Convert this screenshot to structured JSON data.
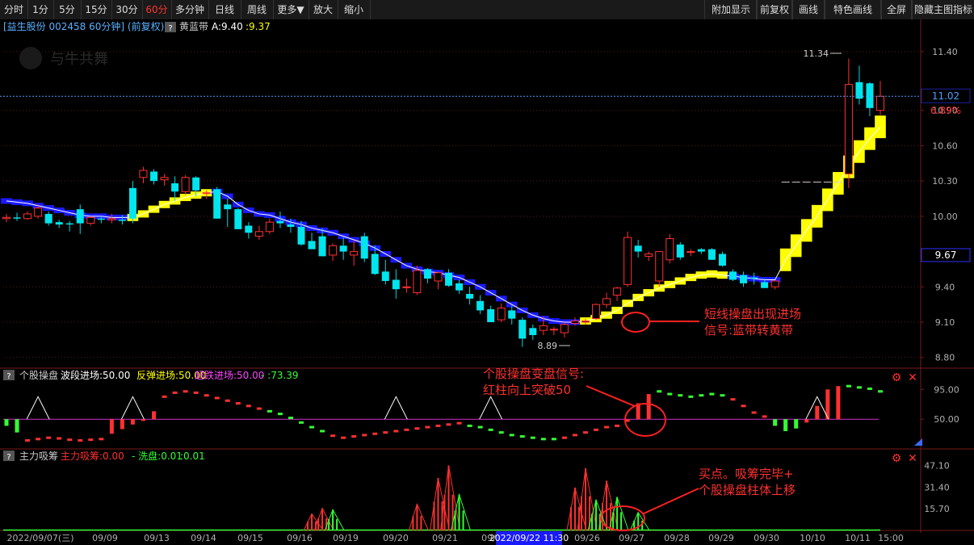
{
  "toolbar": {
    "left": [
      "分时",
      "1分",
      "5分",
      "15分",
      "30分",
      "60分",
      "多分钟",
      "日线",
      "周线",
      "更多▼",
      "放大",
      "缩小"
    ],
    "active": "60分",
    "right": [
      "附加显示",
      "前复权",
      "画线",
      "特色画线",
      "全屏",
      "隐藏主图指标"
    ]
  },
  "info_bar": {
    "stock": "[益生股份 002458 60分钟] (前复权)",
    "indicator_name": "黄蓝带",
    "a_text": "A:9.40",
    "b_text": ":9.37"
  },
  "colors": {
    "up": "#ff3030",
    "down": "#00e5ee",
    "band_yellow": "#ffff00",
    "band_blue": "#1a1aff",
    "bg": "#000000",
    "grid": "#5a1a1a",
    "axis_text": "#b0b0b0"
  },
  "annotations": {
    "main": "短线操盘出现进场\n信号:蓝带转黄带",
    "sub1": "个股操盘变盘信号:\n红柱向上突破50",
    "sub2": "买点。吸筹完毕+\n个股操盘柱体上移"
  },
  "panel1": {
    "title": "个股操盘",
    "legend": [
      {
        "text": "波段进场:50.00",
        "color": "#ffffff"
      },
      {
        "text": "反弹进场:50.00",
        "color": "#ffff00"
      },
      {
        "text": "超跌进场:50.00",
        "color": "#ff44ff"
      },
      {
        "text": "- :73.39",
        "color": "#33ff33"
      }
    ]
  },
  "panel2": {
    "title": "主力吸筹",
    "legend": [
      {
        "text": "主力吸筹:0.00",
        "color": "#ff3030"
      },
      {
        "text": "- 洗盘:0.01",
        "color": "#33ff33"
      },
      {
        "text": ":0.01",
        "color": "#33ff33"
      }
    ]
  },
  "x_labels": [
    "2022/09/07(三)",
    "09/09",
    "09/13",
    "09/14",
    "09/15",
    "09/16",
    "09/19",
    "09/20",
    "09/21",
    "09/22",
    "09/26",
    "09/27",
    "09/28",
    "09/29",
    "09/30",
    "10/10",
    "10/11",
    "15:00"
  ],
  "cursor_label": "2022/09/22 11:30",
  "chart_data": [
    {
      "type": "candlestick",
      "title": "益生股份 002458 60分钟",
      "y_ticks": [
        8.8,
        9.1,
        9.4,
        10.0,
        10.3,
        10.6,
        10.9,
        11.4
      ],
      "ylim": [
        8.75,
        11.55
      ],
      "price_tags": {
        "last": "11.02",
        "pct": "6.89%",
        "band": "9.67"
      },
      "annotations_price": {
        "high": "11.34",
        "low": "8.89"
      },
      "ohlc": [
        [
          9.98,
          10.02,
          9.95,
          9.99
        ],
        [
          9.99,
          10.03,
          9.96,
          9.98
        ],
        [
          9.98,
          10.04,
          9.97,
          10.02
        ],
        [
          10.0,
          10.1,
          9.98,
          10.07
        ],
        [
          10.02,
          10.04,
          9.92,
          9.94
        ],
        [
          9.95,
          9.97,
          9.9,
          9.93
        ],
        [
          9.94,
          9.96,
          9.87,
          9.93
        ],
        [
          10.06,
          10.1,
          9.85,
          9.94
        ],
        [
          9.94,
          10.0,
          9.92,
          9.99
        ],
        [
          9.98,
          10.0,
          9.94,
          9.97
        ],
        [
          9.97,
          10.02,
          9.94,
          9.98
        ],
        [
          9.97,
          10.01,
          9.93,
          9.96
        ],
        [
          10.24,
          10.3,
          9.94,
          9.98
        ],
        [
          10.33,
          10.42,
          10.28,
          10.39
        ],
        [
          10.38,
          10.4,
          10.27,
          10.3
        ],
        [
          10.31,
          10.36,
          10.26,
          10.33
        ],
        [
          10.28,
          10.34,
          10.13,
          10.21
        ],
        [
          10.21,
          10.35,
          10.18,
          10.33
        ],
        [
          10.33,
          10.34,
          10.17,
          10.22
        ],
        [
          10.2,
          10.22,
          10.15,
          10.2
        ],
        [
          10.23,
          10.25,
          9.98,
          9.98
        ],
        [
          10.1,
          10.15,
          9.91,
          10.06
        ],
        [
          10.06,
          10.07,
          9.89,
          9.89
        ],
        [
          9.92,
          9.95,
          9.81,
          9.86
        ],
        [
          9.83,
          9.92,
          9.8,
          9.87
        ],
        [
          9.87,
          9.98,
          9.85,
          9.95
        ],
        [
          9.96,
          10.04,
          9.9,
          9.94
        ],
        [
          9.93,
          9.98,
          9.86,
          9.91
        ],
        [
          9.91,
          9.96,
          9.75,
          9.76
        ],
        [
          9.79,
          9.86,
          9.72,
          9.72
        ],
        [
          9.83,
          9.9,
          9.66,
          9.66
        ],
        [
          9.67,
          9.77,
          9.62,
          9.75
        ],
        [
          9.75,
          9.82,
          9.63,
          9.7
        ],
        [
          9.67,
          9.8,
          9.58,
          9.7
        ],
        [
          9.83,
          9.86,
          9.61,
          9.64
        ],
        [
          9.68,
          9.75,
          9.5,
          9.51
        ],
        [
          9.53,
          9.63,
          9.42,
          9.45
        ],
        [
          9.46,
          9.55,
          9.3,
          9.38
        ],
        [
          9.4,
          9.47,
          9.35,
          9.4
        ],
        [
          9.35,
          9.58,
          9.33,
          9.54
        ],
        [
          9.55,
          9.56,
          9.43,
          9.47
        ],
        [
          9.45,
          9.53,
          9.38,
          9.52
        ],
        [
          9.52,
          9.55,
          9.4,
          9.41
        ],
        [
          9.43,
          9.46,
          9.34,
          9.37
        ],
        [
          9.34,
          9.4,
          9.25,
          9.3
        ],
        [
          9.28,
          9.33,
          9.17,
          9.2
        ],
        [
          9.21,
          9.24,
          9.1,
          9.1
        ],
        [
          9.12,
          9.26,
          9.1,
          9.22
        ],
        [
          9.2,
          9.24,
          9.08,
          9.13
        ],
        [
          9.12,
          9.14,
          8.89,
          8.96
        ],
        [
          9.05,
          9.08,
          8.95,
          8.99
        ],
        [
          9.03,
          9.15,
          8.99,
          9.07
        ],
        [
          9.04,
          9.06,
          8.99,
          9.04
        ],
        [
          9.01,
          9.1,
          8.97,
          9.08
        ],
        [
          9.09,
          9.14,
          9.07,
          9.11
        ],
        [
          9.1,
          9.13,
          9.08,
          9.11
        ],
        [
          9.13,
          9.26,
          9.12,
          9.25
        ],
        [
          9.25,
          9.35,
          9.22,
          9.3
        ],
        [
          9.33,
          9.4,
          9.28,
          9.39
        ],
        [
          9.42,
          9.87,
          9.4,
          9.82
        ],
        [
          9.75,
          9.8,
          9.65,
          9.7
        ],
        [
          9.66,
          9.7,
          9.62,
          9.68
        ],
        [
          9.45,
          9.7,
          9.4,
          9.7
        ],
        [
          9.63,
          9.85,
          9.6,
          9.81
        ],
        [
          9.76,
          9.78,
          9.63,
          9.65
        ],
        [
          9.7,
          9.72,
          9.66,
          9.7
        ],
        [
          9.72,
          9.73,
          9.68,
          9.7
        ],
        [
          9.72,
          9.73,
          9.63,
          9.63
        ],
        [
          9.68,
          9.7,
          9.57,
          9.58
        ],
        [
          9.53,
          9.55,
          9.45,
          9.46
        ],
        [
          9.5,
          9.53,
          9.4,
          9.43
        ],
        [
          9.48,
          9.52,
          9.42,
          9.47
        ],
        [
          9.44,
          9.47,
          9.39,
          9.39
        ],
        [
          9.4,
          9.45,
          9.38,
          9.45
        ],
        [
          10.29,
          10.29,
          10.29,
          10.29
        ],
        [
          10.29,
          10.29,
          10.29,
          10.29
        ],
        [
          10.29,
          10.29,
          10.29,
          10.29
        ],
        [
          10.29,
          10.29,
          10.29,
          10.29
        ],
        [
          10.29,
          10.29,
          10.29,
          10.29
        ],
        [
          10.29,
          10.29,
          10.29,
          10.29
        ],
        [
          10.36,
          11.34,
          10.24,
          11.12
        ],
        [
          11.14,
          11.28,
          10.95,
          11.0
        ],
        [
          11.13,
          11.14,
          10.85,
          10.92
        ],
        [
          10.9,
          11.15,
          10.86,
          11.02
        ]
      ],
      "band": [
        [
          10.13,
          "b"
        ],
        [
          10.12,
          "b"
        ],
        [
          10.11,
          "b"
        ],
        [
          10.09,
          "b"
        ],
        [
          10.07,
          "b"
        ],
        [
          10.05,
          "b"
        ],
        [
          10.03,
          "b"
        ],
        [
          10.01,
          "b"
        ],
        [
          10.0,
          "b"
        ],
        [
          10.0,
          "b"
        ],
        [
          9.99,
          "b"
        ],
        [
          9.99,
          "b"
        ],
        [
          9.99,
          "y"
        ],
        [
          10.02,
          "y"
        ],
        [
          10.06,
          "y"
        ],
        [
          10.1,
          "y"
        ],
        [
          10.13,
          "y"
        ],
        [
          10.16,
          "y"
        ],
        [
          10.18,
          "y"
        ],
        [
          10.2,
          "y"
        ],
        [
          10.21,
          "b"
        ],
        [
          10.17,
          "b"
        ],
        [
          10.1,
          "b"
        ],
        [
          10.05,
          "b"
        ],
        [
          10.02,
          "b"
        ],
        [
          10.01,
          "b"
        ],
        [
          9.98,
          "b"
        ],
        [
          9.95,
          "b"
        ],
        [
          9.93,
          "b"
        ],
        [
          9.9,
          "b"
        ],
        [
          9.88,
          "b"
        ],
        [
          9.86,
          "b"
        ],
        [
          9.83,
          "b"
        ],
        [
          9.8,
          "b"
        ],
        [
          9.77,
          "b"
        ],
        [
          9.73,
          "b"
        ],
        [
          9.68,
          "b"
        ],
        [
          9.63,
          "b"
        ],
        [
          9.58,
          "b"
        ],
        [
          9.55,
          "b"
        ],
        [
          9.53,
          "b"
        ],
        [
          9.52,
          "b"
        ],
        [
          9.5,
          "b"
        ],
        [
          9.48,
          "b"
        ],
        [
          9.44,
          "b"
        ],
        [
          9.4,
          "b"
        ],
        [
          9.35,
          "b"
        ],
        [
          9.3,
          "b"
        ],
        [
          9.25,
          "b"
        ],
        [
          9.2,
          "b"
        ],
        [
          9.16,
          "b"
        ],
        [
          9.13,
          "b"
        ],
        [
          9.11,
          "b"
        ],
        [
          9.1,
          "b"
        ],
        [
          9.1,
          "b"
        ],
        [
          9.11,
          "y"
        ],
        [
          9.13,
          "y"
        ],
        [
          9.16,
          "y"
        ],
        [
          9.2,
          "y"
        ],
        [
          9.26,
          "y"
        ],
        [
          9.31,
          "y"
        ],
        [
          9.35,
          "y"
        ],
        [
          9.39,
          "y"
        ],
        [
          9.42,
          "y"
        ],
        [
          9.45,
          "y"
        ],
        [
          9.48,
          "y"
        ],
        [
          9.5,
          "y"
        ],
        [
          9.51,
          "y"
        ],
        [
          9.5,
          "y"
        ],
        [
          9.49,
          "b"
        ],
        [
          9.48,
          "b"
        ],
        [
          9.47,
          "b"
        ],
        [
          9.46,
          "b"
        ],
        [
          9.46,
          "b"
        ],
        [
          9.63,
          "y"
        ],
        [
          9.75,
          "y"
        ],
        [
          9.88,
          "y"
        ],
        [
          10.0,
          "y"
        ],
        [
          10.14,
          "y"
        ],
        [
          10.28,
          "y"
        ],
        [
          10.42,
          "y"
        ],
        [
          10.55,
          "y"
        ],
        [
          10.66,
          "y"
        ],
        [
          10.76,
          "y"
        ]
      ]
    },
    {
      "type": "indicator",
      "title": "个股操盘",
      "y_ticks": [
        50.0,
        95.0
      ],
      "ylim": [
        10,
        110
      ],
      "ref_line": 50,
      "segments": [
        {
          "kind": "bar",
          "from": 0,
          "to": 1,
          "v": [
            40,
            30
          ]
        },
        {
          "kind": "dot_red",
          "from": 2,
          "to": 9,
          "v": [
            18,
            20,
            22,
            21,
            19,
            18,
            19,
            20
          ]
        },
        {
          "kind": "bar_red",
          "from": 10,
          "to": 13,
          "v": [
            28,
            35,
            42,
            48
          ]
        },
        {
          "kind": "bar_red_up",
          "from": 13,
          "to": 14,
          "v": [
            50,
            62
          ]
        },
        {
          "kind": "dot_red",
          "from": 15,
          "to": 24,
          "v": [
            84,
            90,
            92,
            90,
            86,
            82,
            78,
            74,
            70,
            66
          ]
        },
        {
          "kind": "dot_green",
          "from": 25,
          "to": 30,
          "v": [
            62,
            58,
            52,
            45,
            38,
            32
          ]
        },
        {
          "kind": "dot_red",
          "from": 31,
          "to": 43,
          "v": [
            25,
            22,
            24,
            26,
            28,
            30,
            32,
            34,
            36,
            38,
            40,
            42,
            44
          ]
        },
        {
          "kind": "dot_green",
          "from": 44,
          "to": 52,
          "v": [
            40,
            38,
            34,
            30,
            26,
            24,
            22,
            20,
            20
          ]
        },
        {
          "kind": "dot_red",
          "from": 53,
          "to": 58,
          "v": [
            22,
            26,
            30,
            34,
            38,
            40
          ]
        },
        {
          "kind": "bar_red_up",
          "from": 59,
          "to": 61,
          "v": [
            46,
            74,
            88
          ]
        },
        {
          "kind": "dot_green",
          "from": 62,
          "to": 68,
          "v": [
            92,
            88,
            86,
            84,
            86,
            88,
            86
          ]
        },
        {
          "kind": "dot_red",
          "from": 69,
          "to": 72,
          "v": [
            80,
            70,
            60,
            54
          ]
        },
        {
          "kind": "bar_green",
          "from": 73,
          "to": 75,
          "v": [
            40,
            32,
            36
          ]
        },
        {
          "kind": "bar_red_up",
          "from": 76,
          "to": 79,
          "v": [
            45,
            70,
            95,
            100
          ]
        },
        {
          "kind": "dot_green",
          "from": 80,
          "to": 83,
          "v": [
            100,
            98,
            96,
            92
          ]
        }
      ],
      "triangles": [
        3,
        12,
        37,
        46,
        77
      ]
    },
    {
      "type": "indicator",
      "title": "主力吸筹",
      "y_ticks": [
        15.7,
        31.4,
        47.1
      ],
      "ylim": [
        0,
        52
      ],
      "red_spikes": [
        [
          29,
          12
        ],
        [
          30,
          16
        ],
        [
          39,
          19
        ],
        [
          41,
          38
        ],
        [
          42,
          47
        ],
        [
          54,
          31
        ],
        [
          55,
          45
        ],
        [
          57,
          36
        ]
      ],
      "green_spikes": [
        [
          31,
          15
        ],
        [
          43,
          26
        ],
        [
          56,
          22
        ],
        [
          58,
          24
        ],
        [
          60,
          13
        ]
      ]
    }
  ]
}
